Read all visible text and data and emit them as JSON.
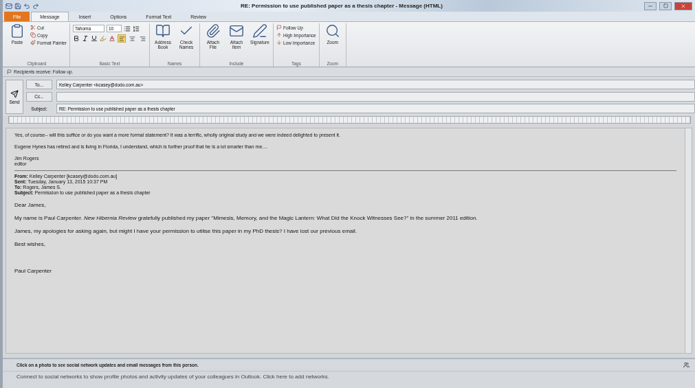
{
  "window": {
    "title": "RE: Permission to use published paper as a thesis chapter  -  Message (HTML)"
  },
  "tabs": [
    {
      "label": "File",
      "kind": "file",
      "selected": false
    },
    {
      "label": "Message",
      "kind": "tab",
      "selected": true
    },
    {
      "label": "Insert",
      "kind": "tab",
      "selected": false
    },
    {
      "label": "Options",
      "kind": "tab",
      "selected": false
    },
    {
      "label": "Format Text",
      "kind": "tab",
      "selected": false
    },
    {
      "label": "Review",
      "kind": "tab",
      "selected": false
    }
  ],
  "ribbon": {
    "groups": [
      {
        "kind": "clipboard",
        "label": "Clipboard",
        "large": [
          "Paste"
        ],
        "small": [
          "Cut",
          "Copy",
          "Format Painter"
        ]
      },
      {
        "kind": "text",
        "label": "Basic Text",
        "font": "Tahoma",
        "size": "10",
        "alignment": [
          {
            "selected": true
          },
          {
            "selected": false
          },
          {
            "selected": false
          }
        ]
      },
      {
        "kind": "buttons",
        "label": "Names",
        "large": [
          "Address Book",
          "Check Names"
        ]
      },
      {
        "kind": "buttons",
        "label": "Include",
        "large": [
          "Attach File",
          "Attach Item",
          "Signature"
        ]
      },
      {
        "kind": "tags",
        "label": "Tags",
        "small": [
          "Follow Up",
          "High Importance",
          "Low Importance"
        ]
      },
      {
        "kind": "buttons",
        "label": "Zoom",
        "large": [
          "Zoom"
        ]
      }
    ]
  },
  "info_bar": "Recipients receive: Follow up.",
  "compose": {
    "send": "Send",
    "to_button": "To...",
    "to": "Kelley Carpenter <kcasey@dodo.com.au>",
    "cc_button": "Cc...",
    "subject_label": "Subject:",
    "subject": "RE: Permission to use published paper as a thesis chapter"
  },
  "body": {
    "reply": [
      "Yes, of course-- will this suffice or do you want a more formal statement?  It was a terrific, wholly original study and we were indeed delighted to present it.",
      "Eugene Hynes has retired and is living in Florida, I understand, which is further proof that he is a lot smarter than me...."
    ],
    "signature": [
      "Jim Rogers",
      "editor"
    ],
    "header": [
      {
        "label": "From:",
        "value": "Kelley Carpenter [kcasey@dodo.com.au]"
      },
      {
        "label": "Sent:",
        "value": "Tuesday, January 13, 2015 10:37 PM"
      },
      {
        "label": "To:",
        "value": "Rogers, James S."
      },
      {
        "label": "Subject:",
        "value": "Permission to use published paper as a thesis chapter"
      }
    ],
    "original": [
      "Dear James,",
      "My name is Paul Carpenter. *New Hibernia Review* gratefully published my paper \"Mimesis, Memory, and the Magic Lantern: What Did the Knock Witnesses See?\" in the summer 2011 edition.",
      "James, my apologies for asking again, but might I have your permission to utilise this paper in my PhD thesis?  I have lost our previous email.",
      "Best wishes,"
    ],
    "closing": "Paul Carpenter"
  },
  "people_pane": {
    "title": "Click on a photo to see social network updates and email messages from this person.",
    "hint": "Connect to social networks to show profile photos and activity updates of your colleagues in Outlook. Click here to add networks."
  }
}
